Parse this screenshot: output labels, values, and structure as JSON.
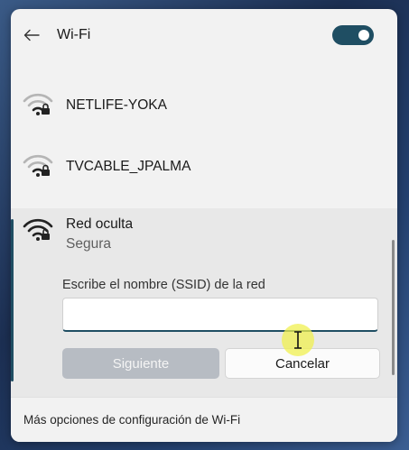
{
  "header": {
    "title": "Wi-Fi",
    "wifi_enabled": true
  },
  "networks": [
    {
      "name": "NETLIFE-YOKA",
      "secured": true
    },
    {
      "name": "TVCABLE_JPALMA",
      "secured": true
    }
  ],
  "hidden_network": {
    "name": "Red oculta",
    "status": "Segura",
    "ssid_label": "Escribe el nombre (SSID) de la red",
    "ssid_value": "",
    "next_label": "Siguiente",
    "cancel_label": "Cancelar"
  },
  "footer": {
    "link_label": "Más opciones de configuración de Wi-Fi"
  },
  "colors": {
    "accent": "#1f4e63",
    "panel_bg": "#f2f2f2",
    "disabled_button": "#b7bcc3"
  }
}
